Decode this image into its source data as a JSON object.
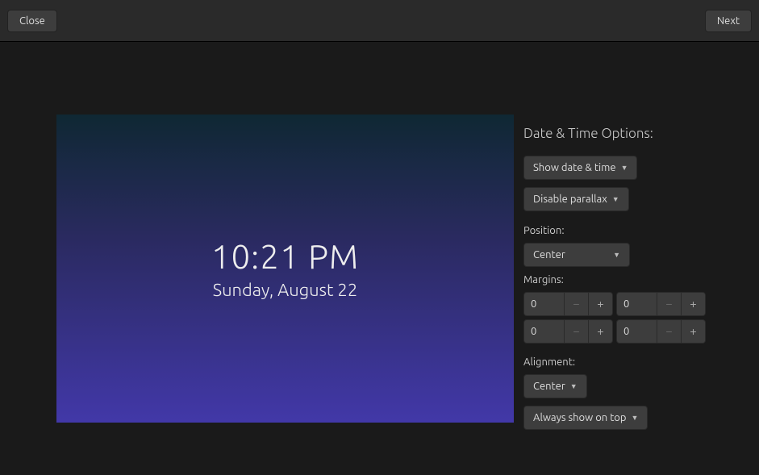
{
  "header": {
    "close_label": "Close",
    "next_label": "Next"
  },
  "preview": {
    "time": "10:21 PM",
    "date": "Sunday, August 22"
  },
  "options": {
    "title": "Date & Time Options:",
    "show_datetime_label": "Show date & time",
    "parallax_label": "Disable parallax",
    "position_label": "Position:",
    "position_value": "Center",
    "margins_label": "Margins:",
    "margins": {
      "top": "0",
      "right": "0",
      "bottom": "0",
      "left": "0"
    },
    "alignment_label": "Alignment:",
    "alignment_value": "Center",
    "zorder_label": "Always show on top"
  }
}
